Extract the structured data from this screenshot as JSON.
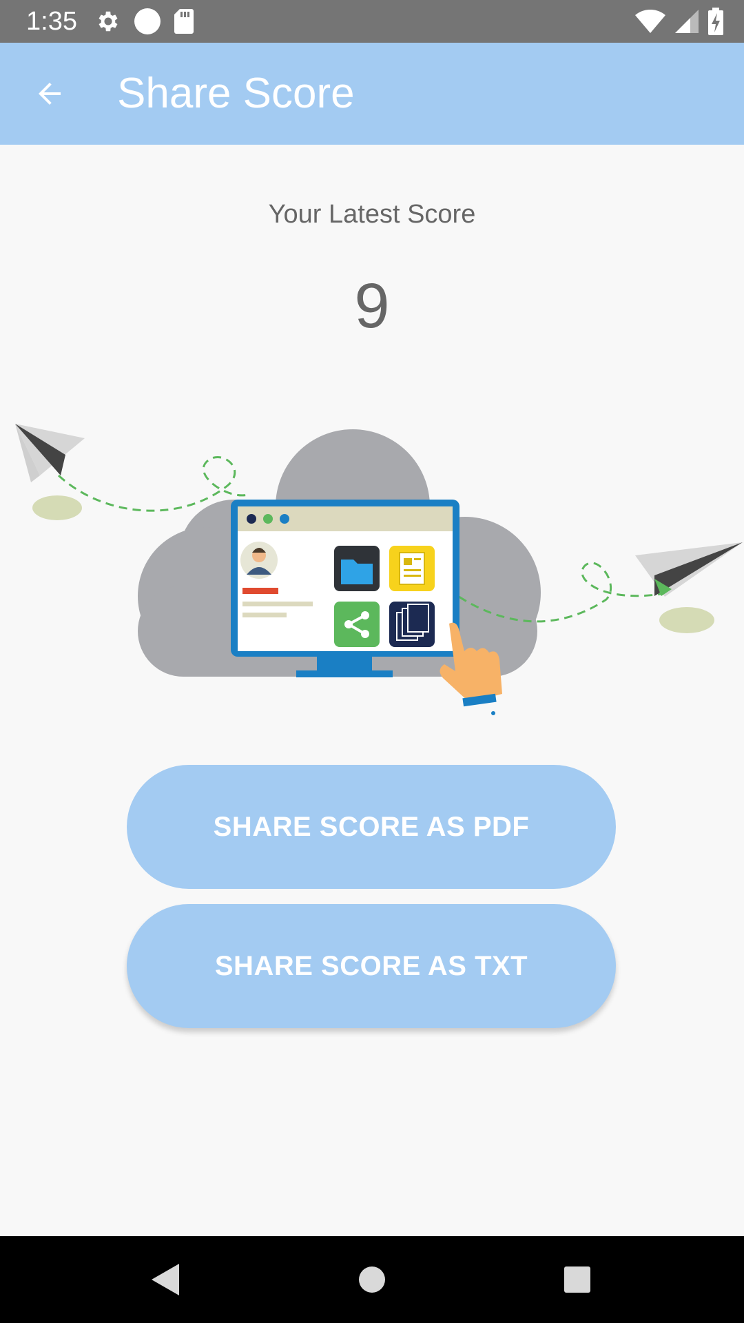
{
  "status_bar": {
    "time": "1:35",
    "icons": [
      "gear-icon",
      "circle-icon",
      "sd-card-icon",
      "wifi-icon",
      "signal-icon",
      "battery-charging-icon"
    ]
  },
  "app_bar": {
    "title": "Share Score",
    "back_icon": "arrow-left-icon",
    "background_color": "#a3cbf2"
  },
  "score": {
    "label": "Your Latest Score",
    "value": "9"
  },
  "illustration": {
    "name": "cloud-sharing-illustration"
  },
  "buttons": {
    "share_pdf": "SHARE SCORE AS PDF",
    "share_txt": "SHARE SCORE AS TXT"
  },
  "nav_bar": {
    "icons": [
      "back-triangle-icon",
      "home-circle-icon",
      "recents-square-icon"
    ]
  }
}
